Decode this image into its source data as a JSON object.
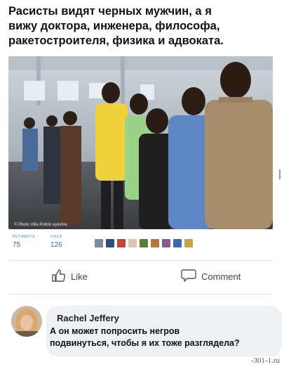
{
  "caption": "Расисты видят черных мужчин, а я\nвижу доктора, инженера, философа,\nракетостроителя, физика и адвоката.",
  "photo": {
    "credit": "© Photo Villa Poltrin eyevine"
  },
  "stats": {
    "retweets_label": "RETWEETS",
    "retweets_value": "75",
    "likes_label": "LIKES",
    "likes_value": "126"
  },
  "actions": {
    "like_label": "Like",
    "comment_label": "Comment"
  },
  "comment": {
    "author": "Rachel Jeffery",
    "text": "А он может попросить негров\nподвинуться, чтобы я их тоже разглядела?"
  },
  "watermark": "-301-1.ru",
  "colors": {
    "stats_blue": "#2f69c7",
    "bubble_bg": "#eef0f3"
  }
}
